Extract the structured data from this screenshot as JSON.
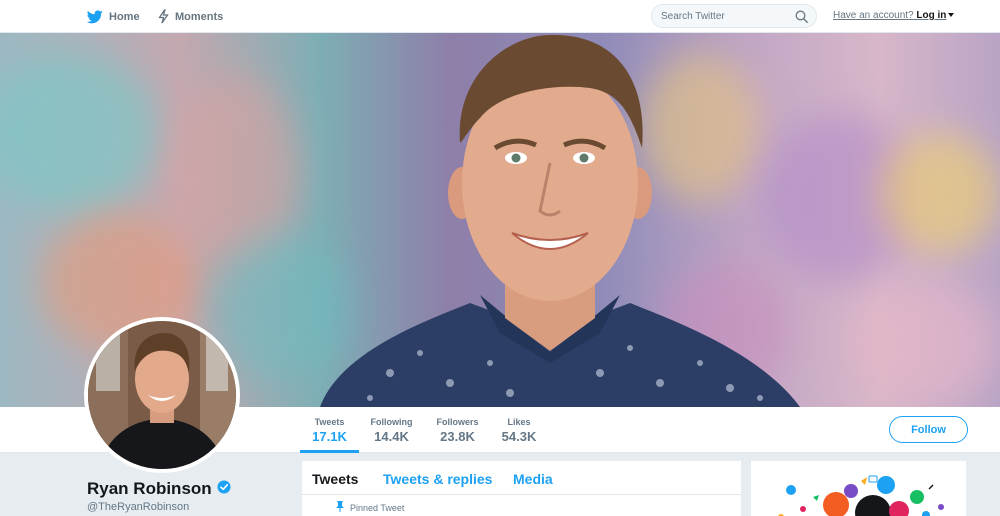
{
  "nav": {
    "home_label": "Home",
    "moments_label": "Moments",
    "search_placeholder": "Search Twitter",
    "account_prompt": "Have an account?",
    "login_label": "Log in"
  },
  "profile": {
    "name": "Ryan Robinson",
    "handle": "@TheRyanRobinson",
    "verified": true
  },
  "stats": [
    {
      "label": "Tweets",
      "value": "17.1K",
      "active": true
    },
    {
      "label": "Following",
      "value": "14.4K",
      "active": false
    },
    {
      "label": "Followers",
      "value": "23.8K",
      "active": false
    },
    {
      "label": "Likes",
      "value": "54.3K",
      "active": false
    }
  ],
  "follow_label": "Follow",
  "timeline": {
    "tabs": [
      "Tweets",
      "Tweets & replies",
      "Media"
    ],
    "pinned_label": "Pinned Tweet"
  },
  "colors": {
    "accent": "#1da1f2",
    "text": "#14171a",
    "muted": "#657786",
    "background": "#e6ecf0"
  },
  "icons": {
    "logo": "twitter-bird-icon",
    "moments": "lightning-icon",
    "search": "magnifier-icon",
    "verified": "verified-badge-icon",
    "pin": "pin-icon"
  }
}
